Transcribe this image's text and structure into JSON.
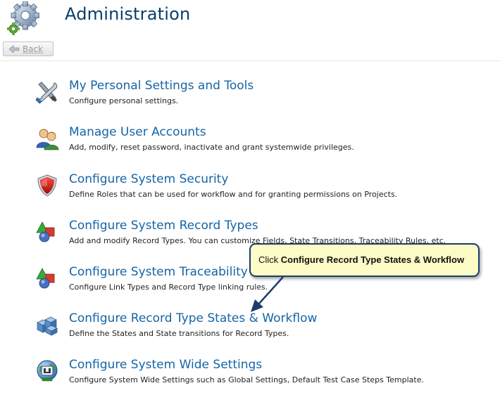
{
  "header": {
    "title": "Administration",
    "logo_icon": "gears-icon"
  },
  "toolbar": {
    "back_label": "Back",
    "back_icon": "back-arrow-icon"
  },
  "menu": {
    "items": [
      {
        "title": "My Personal Settings and Tools",
        "description": "Configure personal settings.",
        "icon": "tools-icon"
      },
      {
        "title": "Manage User Accounts",
        "description": "Add, modify, reset password, inactivate and grant systemwide privileges.",
        "icon": "users-icon"
      },
      {
        "title": "Configure System Security",
        "description": "Define Roles that can be used for workflow and for granting permissions on Projects.",
        "icon": "shield-icon"
      },
      {
        "title": "Configure System Record Types",
        "description": "Add and modify Record Types. You can customize Fields, State Transitions, Traceability Rules, etc.",
        "icon": "shapes-icon"
      },
      {
        "title": "Configure System Traceability",
        "description": "Configure Link Types and Record Type linking rules.",
        "icon": "shapes-icon"
      },
      {
        "title": "Configure Record Type States & Workflow",
        "description": "Define the States and State transitions for Record Types.",
        "icon": "workflow-cubes-icon"
      },
      {
        "title": "Configure System Wide Settings",
        "description": "Configure System Wide Settings such as Global Settings, Default Test Case Steps Template.",
        "icon": "globe-settings-icon"
      }
    ]
  },
  "callout": {
    "prefix": "Click ",
    "emphasis": "Configure Record Type States & Workflow"
  }
}
